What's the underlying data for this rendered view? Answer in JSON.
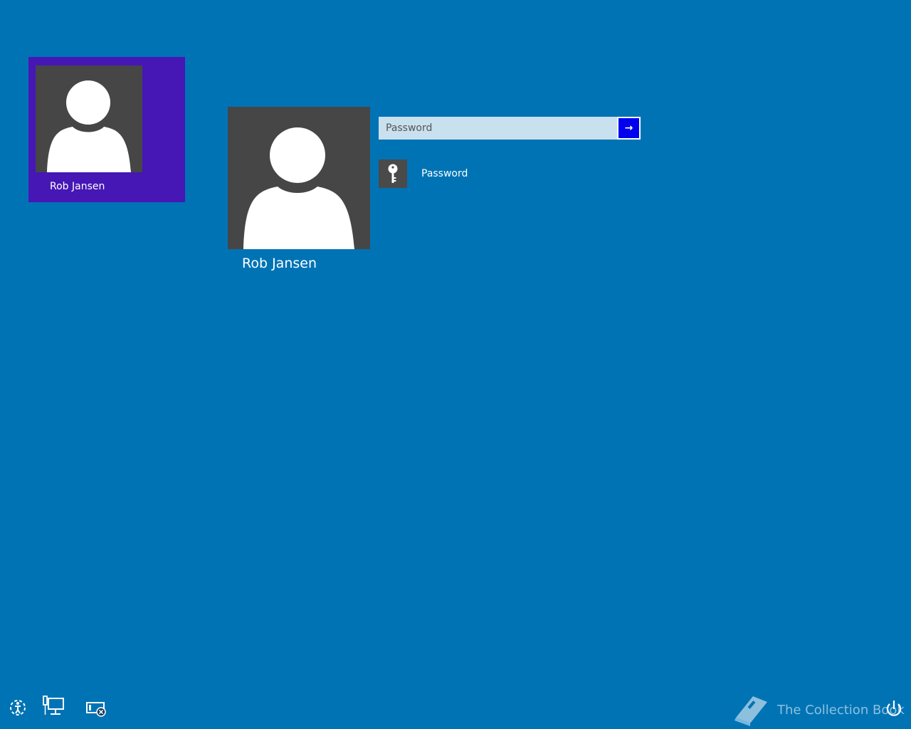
{
  "user_list": [
    {
      "name": "Rob Jansen",
      "selected": true,
      "tile_color": "#4617b4"
    }
  ],
  "selected_user": {
    "name": "Rob Jansen"
  },
  "password": {
    "placeholder": "Password",
    "value": "",
    "submit_icon": "arrow-right-icon",
    "submit_color": "#0000ee"
  },
  "signin_options": [
    {
      "label": "Password",
      "icon": "key-icon"
    }
  ],
  "bottom_bar": {
    "icons": [
      "ease-of-access-icon",
      "network-icon",
      "screenshot-icon",
      "power-icon"
    ]
  },
  "watermark": {
    "text": "The Collection Book",
    "icon": "book-icon"
  },
  "colors": {
    "background": "#0073b5",
    "avatar_bg": "#464646"
  }
}
